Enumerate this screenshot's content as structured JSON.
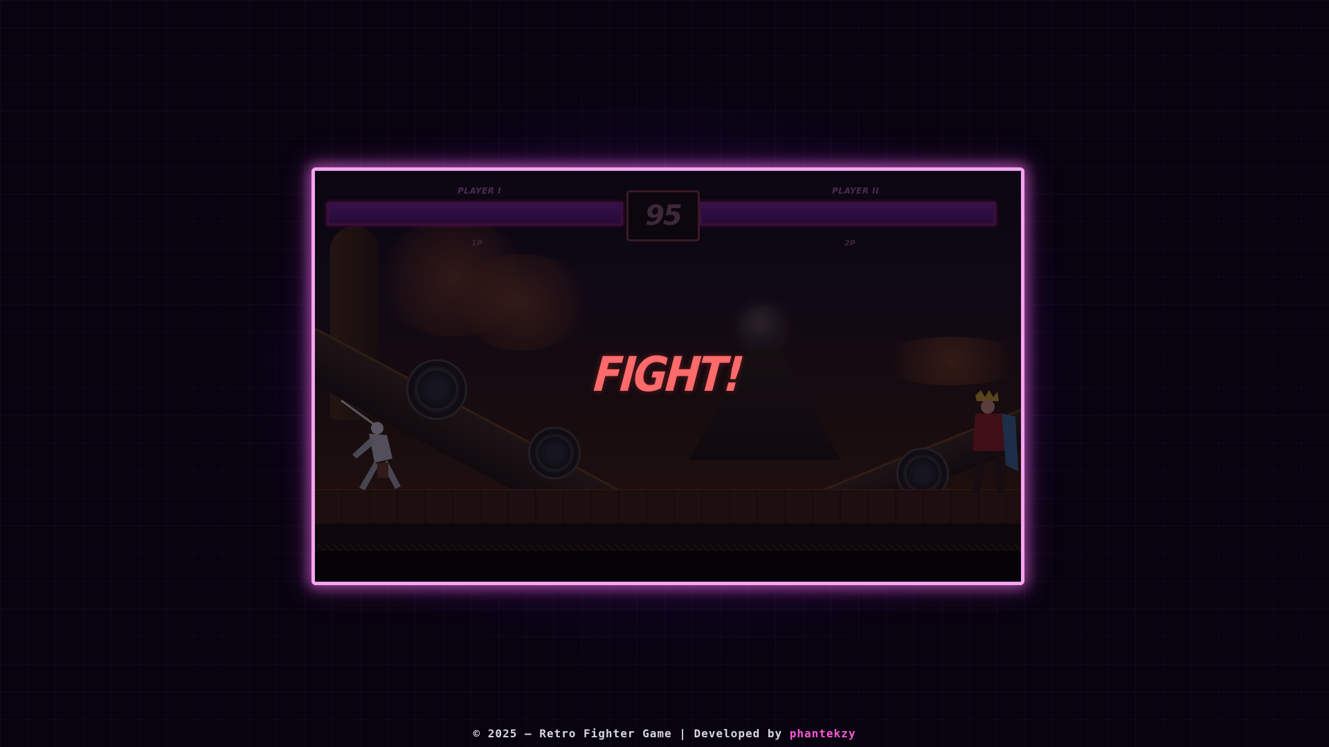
{
  "hud": {
    "player1": {
      "name": "PLAYER I",
      "tag": "1P",
      "health": 1.0
    },
    "player2": {
      "name": "PLAYER II",
      "tag": "2P",
      "health": 1.0
    },
    "timer": "95"
  },
  "announcement": "FIGHT!",
  "footer": {
    "prefix": "© 2025 — Retro Fighter Game | Developed by ",
    "developer": "phantekzy"
  },
  "colors": {
    "frame_border": "#f7a4f0",
    "fight_text": "#ff6a6a",
    "developer_link": "#ff57d8",
    "background": "#07030f"
  }
}
